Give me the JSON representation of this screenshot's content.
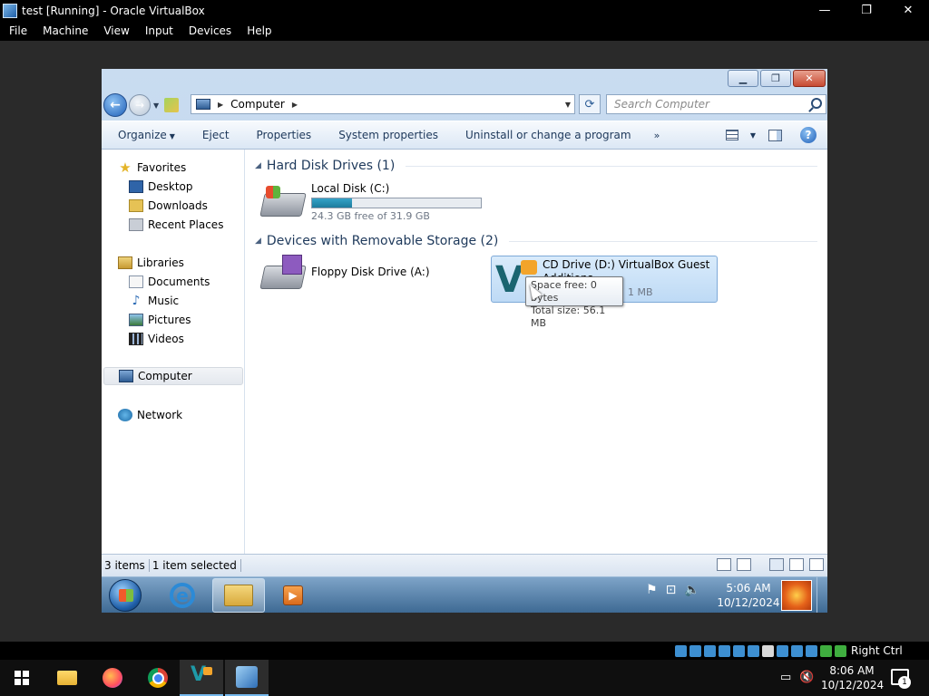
{
  "host": {
    "title": "test [Running] - Oracle VirtualBox",
    "controls": {
      "minimize": "—",
      "restore": "❐",
      "close": "✕"
    },
    "menu": [
      "File",
      "Machine",
      "View",
      "Input",
      "Devices",
      "Help"
    ],
    "host_key": "Right Ctrl",
    "taskbar": {
      "time": "8:06 AM",
      "date": "10/12/2024",
      "notification_count": "1"
    }
  },
  "explorer": {
    "breadcrumb": "Computer",
    "search_placeholder": "Search Computer",
    "commands": {
      "organize": "Organize",
      "eject": "Eject",
      "properties": "Properties",
      "system_properties": "System properties",
      "uninstall": "Uninstall or change a program",
      "more": "»"
    },
    "nav": {
      "favorites": "Favorites",
      "desktop": "Desktop",
      "downloads": "Downloads",
      "recent_places": "Recent Places",
      "libraries": "Libraries",
      "documents": "Documents",
      "music": "Music",
      "pictures": "Pictures",
      "videos": "Videos",
      "computer": "Computer",
      "network": "Network"
    },
    "groups": {
      "hdd": "Hard Disk Drives (1)",
      "removable": "Devices with Removable Storage (2)"
    },
    "drives": {
      "c_name": "Local Disk (C:)",
      "c_free": "24.3 GB free of 31.9 GB",
      "c_used_fraction": 0.238,
      "a_name": "Floppy Disk Drive (A:)",
      "d_name": "CD Drive (D:) VirtualBox Guest Additions",
      "d_size_partial": "1 MB"
    },
    "tooltip": {
      "line1": "Space free: 0 bytes",
      "line2": "Total size: 56.1 MB"
    },
    "status": {
      "items": "3 items",
      "selected": "1 item selected"
    }
  },
  "guest_taskbar": {
    "time": "5:06 AM",
    "date": "10/12/2024"
  }
}
